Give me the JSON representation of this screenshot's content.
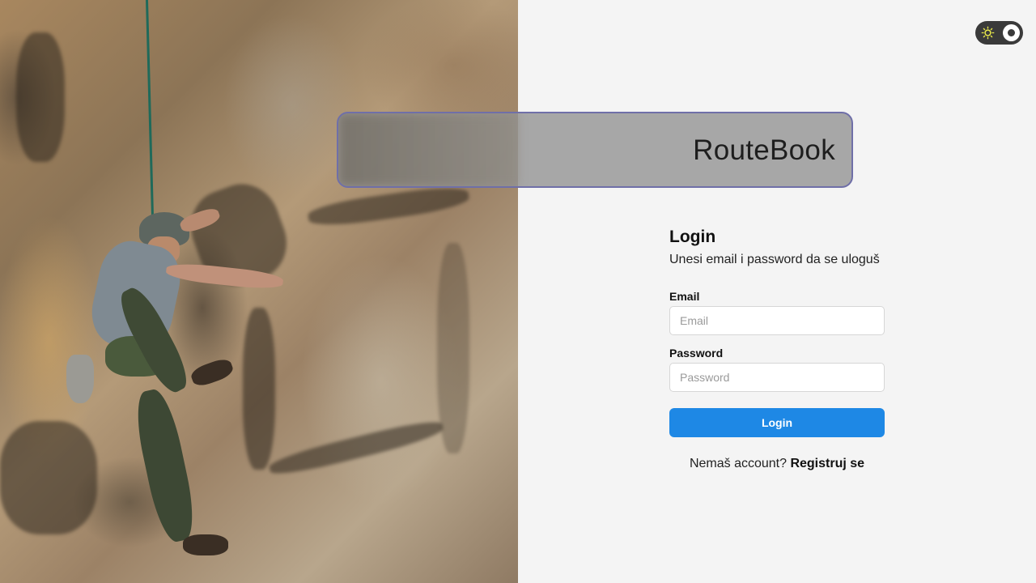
{
  "brand": {
    "title": "RouteBook"
  },
  "theme_toggle": {
    "mode": "light",
    "icon": "sun-icon"
  },
  "hero": {
    "description_icon": "rock-climber-photo"
  },
  "login": {
    "title": "Login",
    "subtitle": "Unesi email i password da se uloguš",
    "email_label": "Email",
    "email_placeholder": "Email",
    "email_value": "",
    "password_label": "Password",
    "password_placeholder": "Password",
    "password_value": "",
    "submit_label": "Login",
    "no_account_text": "Nemaš account?",
    "register_label": "Registruj se"
  },
  "colors": {
    "primary": "#1e88e5",
    "page_background": "#f4f4f4",
    "toggle_background": "#3a3a3a",
    "banner_border": "#6f6fa8",
    "sun": "#e8e84a"
  }
}
